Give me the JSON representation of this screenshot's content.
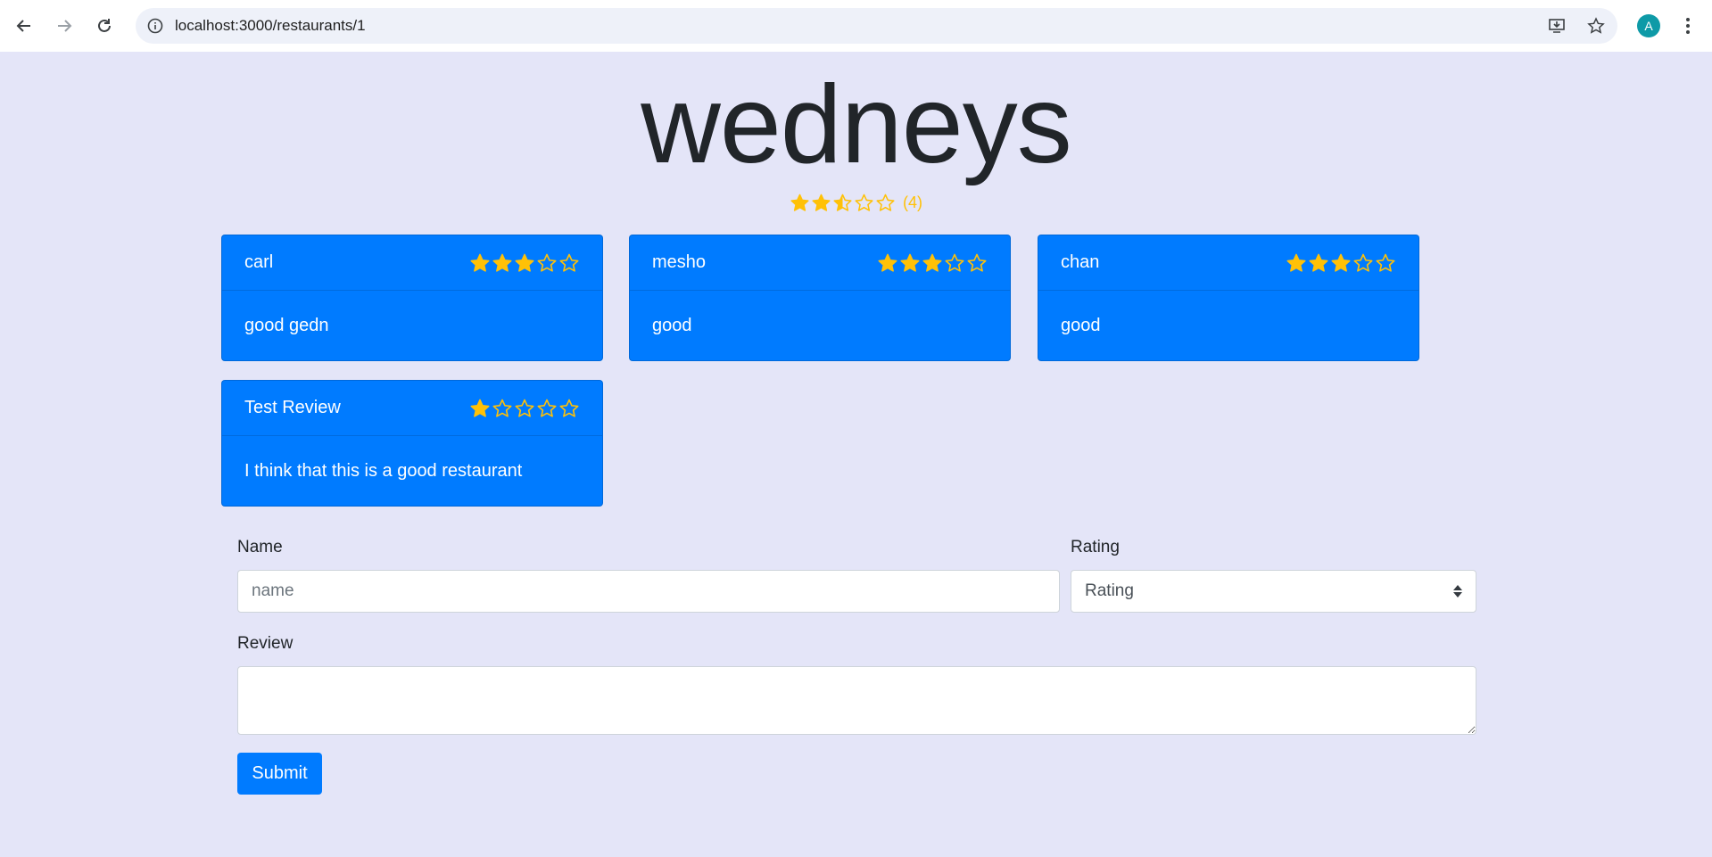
{
  "browser": {
    "url": "localhost:3000/restaurants/1",
    "avatar_letter": "A"
  },
  "restaurant": {
    "name": "wedneys",
    "average_rating": 2.5,
    "review_count": "(4)"
  },
  "colors": {
    "star": "#ffc107",
    "card": "#007bff",
    "background": "#e4e5f8"
  },
  "reviews": [
    {
      "name": "carl",
      "rating": 3,
      "text": "good gedn"
    },
    {
      "name": "mesho",
      "rating": 3,
      "text": "good"
    },
    {
      "name": "chan",
      "rating": 3,
      "text": "good"
    },
    {
      "name": "Test Review",
      "rating": 1,
      "text": "I think that this is a good restaurant"
    }
  ],
  "form": {
    "name_label": "Name",
    "name_placeholder": "name",
    "name_value": "",
    "rating_label": "Rating",
    "rating_selected": "Rating",
    "review_label": "Review",
    "review_value": "",
    "submit_label": "Submit"
  }
}
